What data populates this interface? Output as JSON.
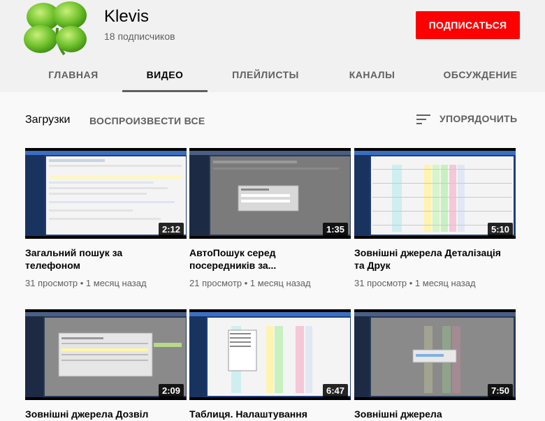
{
  "channel": {
    "name": "Klevis",
    "subscribers": "18 подписчиков",
    "subscribe_label": "ПОДПИСАТЬСЯ"
  },
  "tabs": [
    {
      "label": "ГЛАВНАЯ",
      "active": false
    },
    {
      "label": "ВИДЕО",
      "active": true
    },
    {
      "label": "ПЛЕЙЛИСТЫ",
      "active": false
    },
    {
      "label": "КАНАЛЫ",
      "active": false
    },
    {
      "label": "ОБСУЖДЕНИЕ",
      "active": false
    }
  ],
  "section": {
    "title": "Загрузки",
    "play_all": "ВОСПРОИЗВЕСТИ ВСЕ",
    "sort_label": "УПОРЯДОЧИТЬ"
  },
  "videos": [
    {
      "title": "Загальний пошук за телефоном",
      "duration": "2:12",
      "views": "31 просмотр",
      "age": "1 месяц назад"
    },
    {
      "title": "АвтоПошук серед посередників за...",
      "duration": "1:35",
      "views": "21 просмотр",
      "age": "1 месяц назад"
    },
    {
      "title": "Зовнішні джерела Деталізація та Друк",
      "duration": "5:10",
      "views": "31 просмотр",
      "age": "1 месяц назад"
    },
    {
      "title": "Зовнішні джерела Дозвіл",
      "duration": "2:09",
      "views": "",
      "age": ""
    },
    {
      "title": "Таблиця. Налаштування",
      "duration": "6:47",
      "views": "",
      "age": ""
    },
    {
      "title": "Зовнішні джерела",
      "duration": "7:50",
      "views": "",
      "age": ""
    }
  ],
  "colors": {
    "accent": "#ff0000",
    "header_bg": "#f1f1f1",
    "page_bg": "#f9f9f9",
    "muted_text": "#606060"
  },
  "icons": {
    "avatar": "four-leaf-clover-icon",
    "sort": "sort-lines-icon"
  }
}
